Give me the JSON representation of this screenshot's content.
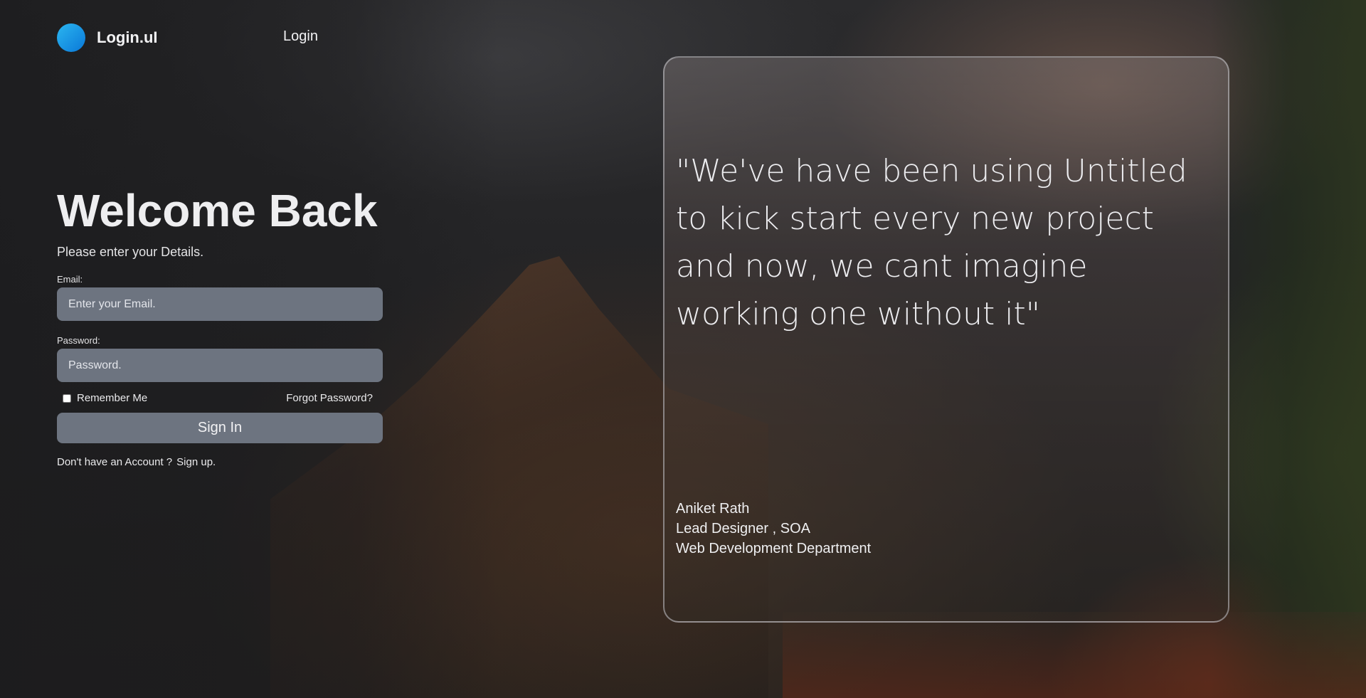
{
  "header": {
    "brand": "Login.uI",
    "nav_login": "Login"
  },
  "form": {
    "title": "Welcome Back",
    "subtitle": "Please enter your Details.",
    "email_label": "Email:",
    "email_placeholder": "Enter your Email.",
    "password_label": "Password:",
    "password_placeholder": "Password.",
    "remember_label": "Remember Me",
    "remember_checked": false,
    "forgot_label": "Forgot Password?",
    "signin_label": "Sign In",
    "no_account_text": "Don't have an Account ?",
    "signup_label": "Sign up."
  },
  "testimonial": {
    "quote": "\"We've have been using Untitled to kick start every new project and now, we cant imagine working one without it\"",
    "author_name": "Aniket Rath",
    "author_role": "Lead Designer , SOA",
    "author_department": "Web Development Department"
  },
  "colors": {
    "logo_gradient_start": "#2bb6f0",
    "logo_gradient_end": "#0a78d8",
    "input_background": "#6d7480",
    "card_border": "#c8c8cd"
  },
  "icons": {
    "logo": "circle-logo-icon"
  }
}
